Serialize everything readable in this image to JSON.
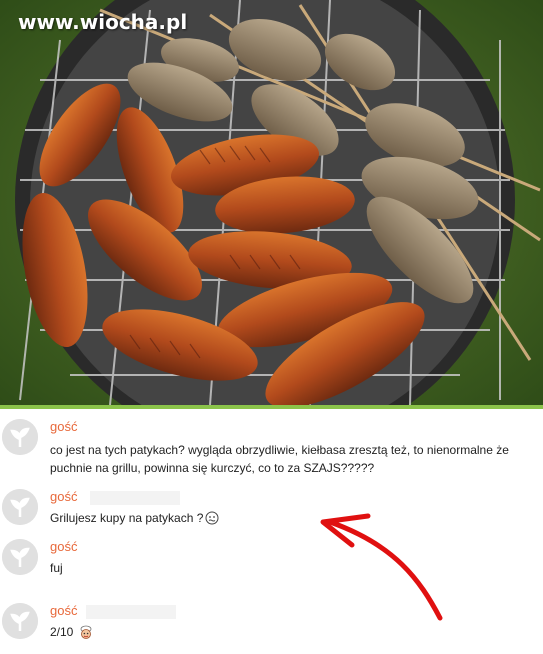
{
  "watermark": "www.wiocha.pl",
  "photo": {
    "alt": "grilled sausages and kebabs on a round grill"
  },
  "accent_color": "#8bc34a",
  "author_color": "#e8683a",
  "arrow_color": "#e01010",
  "comments": [
    {
      "author": "gość",
      "text": "co jest na tych patykach? wygląda obrzydliwie, kiełbasa zresztą też, to nienormalne że puchnie na grillu, powinna się kurczyć, co to za SZAJS?????",
      "emoji": ""
    },
    {
      "author": "gość",
      "text": "Grilujesz kupy na patykach ?",
      "emoji": "sick-face-icon"
    },
    {
      "author": "gość",
      "text": "fuj",
      "emoji": ""
    },
    {
      "author": "gość",
      "text": "2/10",
      "emoji": "chef-face-icon"
    }
  ]
}
